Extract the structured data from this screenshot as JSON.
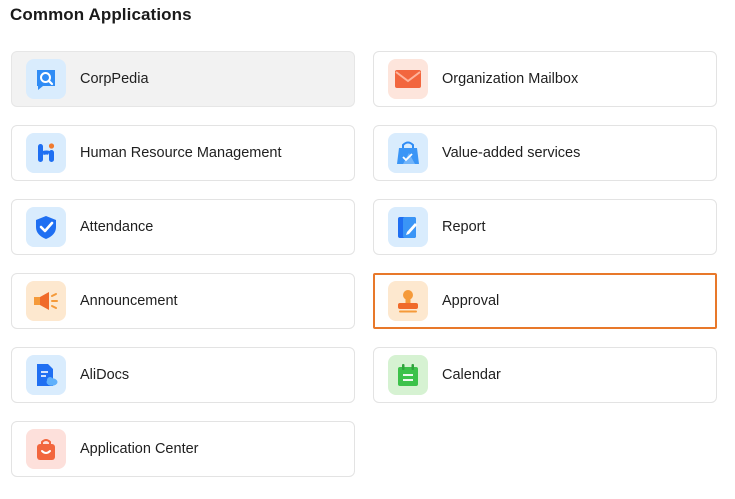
{
  "section": {
    "title": "Common Applications"
  },
  "apps": [
    {
      "label": "CorpPedia",
      "icon": "corppedia-icon",
      "state": "hover"
    },
    {
      "label": "Organization Mailbox",
      "icon": "mail-icon"
    },
    {
      "label": "Human Resource Management",
      "icon": "hr-icon"
    },
    {
      "label": "Value-added services",
      "icon": "shopping-bag-icon"
    },
    {
      "label": "Attendance",
      "icon": "shield-check-icon"
    },
    {
      "label": "Report",
      "icon": "report-edit-icon"
    },
    {
      "label": "Announcement",
      "icon": "megaphone-icon"
    },
    {
      "label": "Approval",
      "icon": "stamp-icon",
      "state": "selected"
    },
    {
      "label": "AliDocs",
      "icon": "document-cloud-icon"
    },
    {
      "label": "Calendar",
      "icon": "calendar-icon"
    },
    {
      "label": "Application Center",
      "icon": "app-bag-icon"
    }
  ],
  "colors": {
    "selected_border": "#e8782a",
    "hover_background": "#f2f2f2"
  }
}
